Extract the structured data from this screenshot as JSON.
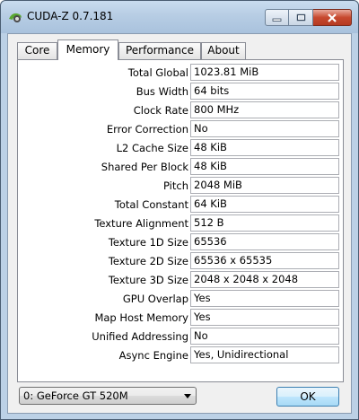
{
  "window": {
    "title": "CUDA-Z 0.7.181",
    "icon": "cuda-z-icon"
  },
  "tabs": [
    {
      "label": "Core",
      "active": false
    },
    {
      "label": "Memory",
      "active": true
    },
    {
      "label": "Performance",
      "active": false
    },
    {
      "label": "About",
      "active": false
    }
  ],
  "memory": {
    "rows": [
      {
        "label": "Total Global",
        "value": "1023.81 MiB"
      },
      {
        "label": "Bus Width",
        "value": "64 bits"
      },
      {
        "label": "Clock Rate",
        "value": "800 MHz"
      },
      {
        "label": "Error Correction",
        "value": "No"
      },
      {
        "label": "L2 Cache Size",
        "value": "48 KiB"
      },
      {
        "label": "Shared Per Block",
        "value": "48 KiB"
      },
      {
        "label": "Pitch",
        "value": "2048 MiB"
      },
      {
        "label": "Total Constant",
        "value": "64 KiB"
      },
      {
        "label": "Texture Alignment",
        "value": "512 B"
      },
      {
        "label": "Texture 1D Size",
        "value": "65536"
      },
      {
        "label": "Texture 2D Size",
        "value": "65536 x 65535"
      },
      {
        "label": "Texture 3D Size",
        "value": "2048 x 2048 x 2048"
      },
      {
        "label": "GPU Overlap",
        "value": "Yes"
      },
      {
        "label": "Map Host Memory",
        "value": "Yes"
      },
      {
        "label": "Unified Addressing",
        "value": "No"
      },
      {
        "label": "Async Engine",
        "value": "Yes, Unidirectional"
      }
    ]
  },
  "footer": {
    "device_selected": "0: GeForce GT 520M",
    "ok_label": "OK"
  },
  "colors": {
    "close_button": "#c7492f",
    "ok_border": "#3c7fb1"
  }
}
